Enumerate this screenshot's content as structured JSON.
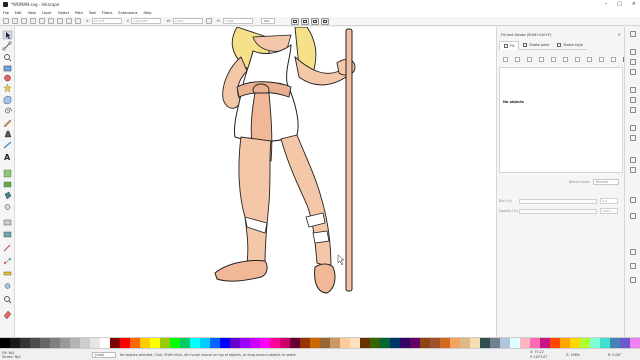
{
  "window": {
    "title": "*WOMAN.svg - Inkscape",
    "controls": [
      "minimize",
      "maximize",
      "close"
    ]
  },
  "menubar": [
    "File",
    "Edit",
    "View",
    "Layer",
    "Object",
    "Path",
    "Text",
    "Filters",
    "Extensions",
    "Help"
  ],
  "controls_bar": {
    "x_label": "X:",
    "x_value": "53.378",
    "y_label": "Y:",
    "y_value": "1164.687",
    "w_label": "W:",
    "w_value": "6.633",
    "h_label": "H:",
    "h_value": "1.288",
    "unit": "mm"
  },
  "fill_stroke_panel": {
    "title": "Fill and Stroke (Shift+Ctrl+F)",
    "close_glyph": "×",
    "tabs": [
      "Fill",
      "Stroke paint",
      "Stroke style"
    ],
    "empty_text": "No objects",
    "blend_label": "Blend mode:",
    "blend_value": "Normal",
    "blur_label": "Blur (%)",
    "blur_value": "0.0",
    "opacity_label": "Opacity (%)",
    "opacity_value": "100.0"
  },
  "palette": {
    "colors": [
      "#000000",
      "#1a1a1a",
      "#333333",
      "#4d4d4d",
      "#666666",
      "#808080",
      "#999999",
      "#b3b3b3",
      "#cccccc",
      "#e6e6e6",
      "#ffffff",
      "#800000",
      "#ff0000",
      "#ff6600",
      "#ffcc00",
      "#ffff00",
      "#99cc00",
      "#00ff00",
      "#00cc66",
      "#00ffff",
      "#00ccff",
      "#0066ff",
      "#0000ff",
      "#6600cc",
      "#9900ff",
      "#cc00ff",
      "#ff00ff",
      "#ff0099",
      "#cc0066",
      "#660033",
      "#993300",
      "#cc6600",
      "#996633",
      "#cc9966",
      "#ffcc99",
      "#ffe0c0",
      "#663300",
      "#336600",
      "#006633",
      "#003366",
      "#330066",
      "#660066",
      "#8b4513",
      "#a0522d",
      "#d2691e",
      "#f4a460",
      "#deb887",
      "#f5deb3",
      "#2f4f4f",
      "#708090",
      "#b0c4de",
      "#e0ffff",
      "#ffb6c1",
      "#ff69b4",
      "#c71585",
      "#ff4500",
      "#ffa500",
      "#ffd700",
      "#adff2f",
      "#7fffd4",
      "#40e0d0",
      "#4682b4",
      "#6a5acd",
      "#ee82ee"
    ]
  },
  "statusbar": {
    "fill_label": "Fill:",
    "fill_value": "N/A",
    "stroke_label": "Stroke:",
    "stroke_value": "N/A",
    "layer": "(root)",
    "message": "No objects selected. Click, Shift+click, Alt+scroll mouse on top of objects, or drag around objects to select.",
    "x_coord": "X: 75.22",
    "y_coord": "Y: 1073.07",
    "zoom_label": "Z:",
    "zoom": "196%",
    "rotation_label": "R:",
    "rotation": "0.00°"
  }
}
